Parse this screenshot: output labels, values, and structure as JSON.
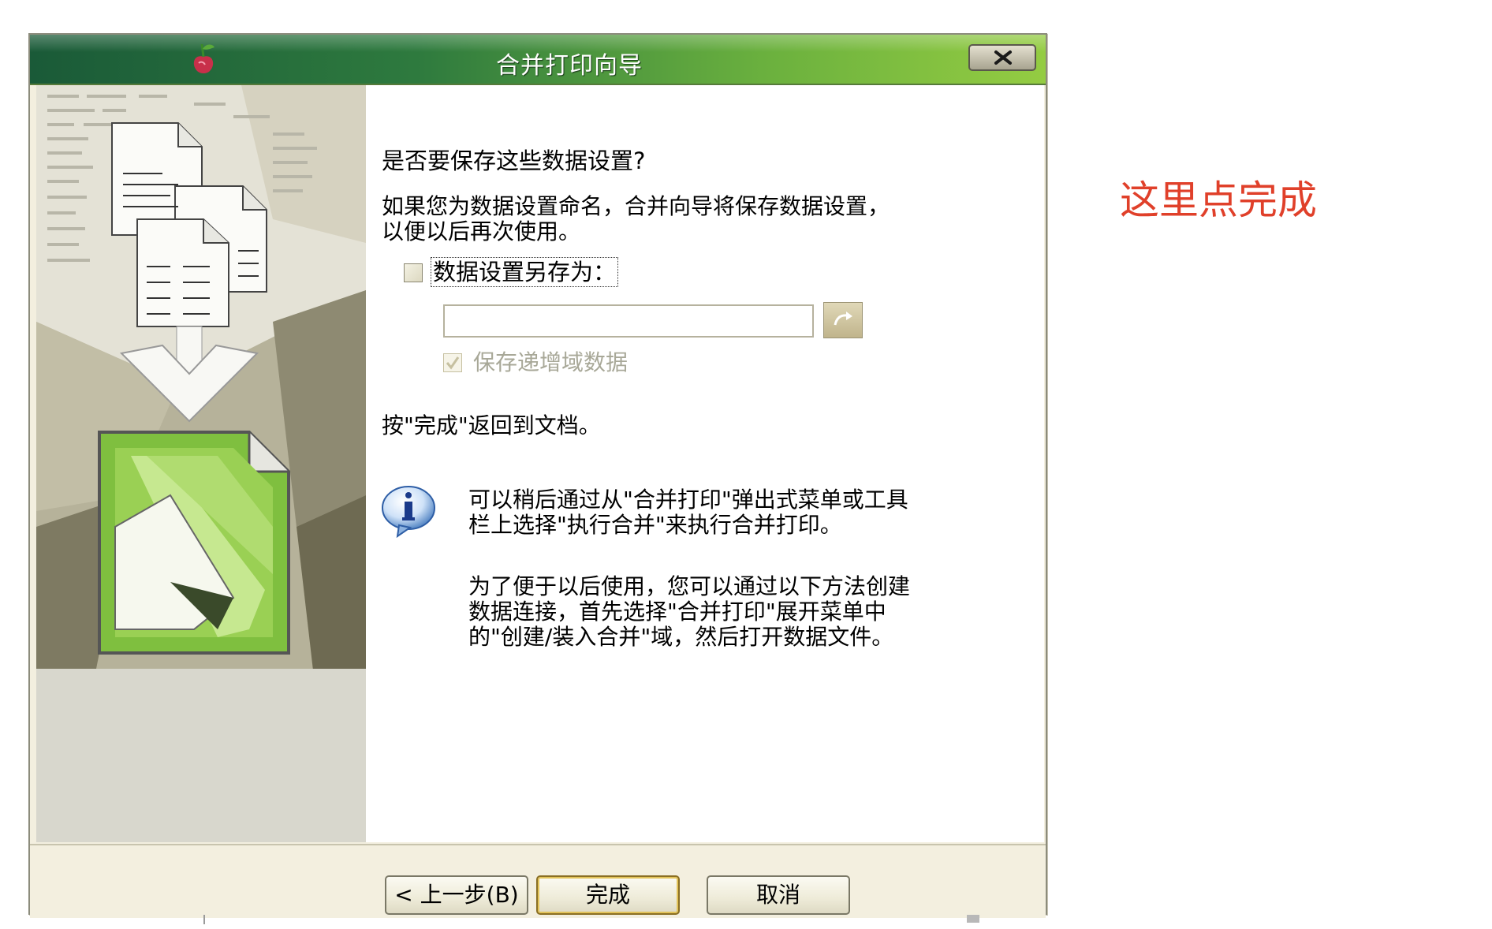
{
  "window": {
    "title": "合并打印向导"
  },
  "content": {
    "question": "是否要保存这些数据设置?",
    "description": "如果您为数据设置命名，合并向导将保存数据设置，以便以后再次使用。",
    "save_as_checkbox": {
      "label": "数据设置另存为：",
      "checked": false
    },
    "name_input": {
      "value": ""
    },
    "save_incremental_checkbox": {
      "label": "保存递增域数据",
      "checked": true,
      "enabled": false
    },
    "finish_hint": "按\"完成\"返回到文档。",
    "info_text_1": "可以稍后通过从\"合并打印\"弹出式菜单或工具栏上选择\"执行合并\"来执行合并打印。",
    "info_text_2": "为了便于以后使用，您可以通过以下方法创建数据连接，首先选择\"合并打印\"展开菜单中的\"创建/装入合并\"域，然后打开数据文件。"
  },
  "buttons": {
    "prev": "< 上一步(B)",
    "finish": "完成",
    "cancel": "取消"
  },
  "annotation": {
    "text": "这里点完成",
    "color": "#e0402a"
  },
  "icons": [
    "app-icon",
    "close-icon",
    "apply-arrow-icon",
    "info-icon",
    "checkmark-icon"
  ]
}
